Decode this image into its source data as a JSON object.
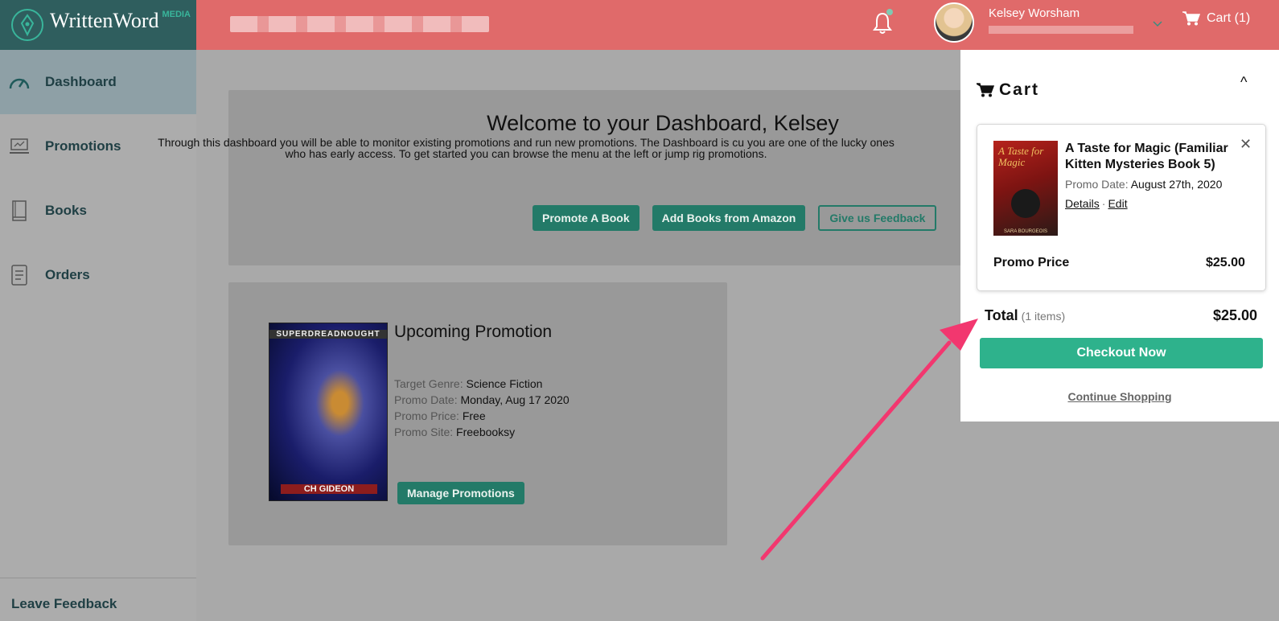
{
  "header": {
    "logo_text": "WrittenWord",
    "logo_sup": "MEDIA",
    "user_name": "Kelsey Worsham",
    "cart_label": "Cart (1)",
    "colors": {
      "topbar": "#e06a6a",
      "logo_bg": "#2f5e5e",
      "accent": "#2eb28c"
    }
  },
  "sidebar": {
    "items": [
      {
        "label": "Dashboard",
        "icon": "gauge-icon",
        "active": true
      },
      {
        "label": "Promotions",
        "icon": "laptop-chart-icon"
      },
      {
        "label": "Books",
        "icon": "book-icon"
      },
      {
        "label": "Orders",
        "icon": "document-icon"
      }
    ],
    "footer": "Leave Feedback"
  },
  "welcome": {
    "title": "Welcome to your Dashboard, Kelsey",
    "body": "Through this dashboard you will be able to monitor existing promotions and run new promotions. The Dashboard is cu you are one of the lucky ones who has early access. To get started you can browse the menu at the left or jump rig promotions.",
    "buttons": [
      "Promote A Book",
      "Add Books from Amazon",
      "Give us Feedback"
    ]
  },
  "promotion": {
    "title": "Upcoming Promotion",
    "cover_title": "SUPERDREADNOUGHT",
    "cover_author": "CH GIDEON",
    "fields": [
      {
        "k": "Target Genre:",
        "v": "Science Fiction"
      },
      {
        "k": "Promo Date:",
        "v": "Monday, Aug 17 2020"
      },
      {
        "k": "Promo Price:",
        "v": "Free"
      },
      {
        "k": "Promo Site:",
        "v": "Freebooksy"
      }
    ],
    "button": "Manage Promotions"
  },
  "cart": {
    "title": "Cart",
    "collapse": "^",
    "item": {
      "title": "A Taste for Magic (Familiar Kitten Mysteries Book 5)",
      "cover_text": "A Taste for Magic",
      "cover_author": "SARA BOURGEOIS",
      "date_label": "Promo Date:",
      "date": "August 27th, 2020",
      "details": "Details",
      "sep": "·",
      "edit": "Edit",
      "price_label": "Promo Price",
      "price": "$25.00"
    },
    "total_label": "Total",
    "total_count": "(1 items)",
    "total": "$25.00",
    "checkout": "Checkout Now",
    "continue": "Continue Shopping"
  }
}
